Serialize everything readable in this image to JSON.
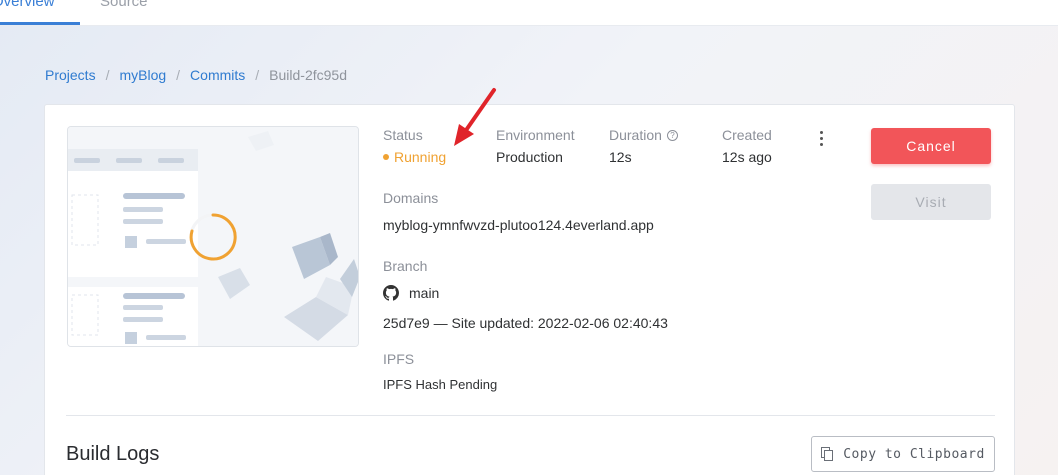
{
  "tabs": {
    "overview": "Overview",
    "source": "Source"
  },
  "breadcrumb": {
    "projects": "Projects",
    "project": "myBlog",
    "commits": "Commits",
    "current": "Build-2fc95d",
    "separator": "/"
  },
  "build": {
    "status_label": "Status",
    "status_value": "Running",
    "environment_label": "Environment",
    "environment_value": "Production",
    "duration_label": "Duration",
    "duration_value": "12s",
    "created_label": "Created",
    "created_value": "12s ago",
    "domains_label": "Domains",
    "domains_value": "myblog-ymnfwvzd-plutoo124.4everland.app",
    "branch_label": "Branch",
    "branch_value": "main",
    "commit_info": "25d7e9 — Site updated: 2022-02-06 02:40:43",
    "ipfs_label": "IPFS",
    "ipfs_value": "IPFS Hash Pending"
  },
  "actions": {
    "cancel_label": "Cancel",
    "visit_label": "Visit",
    "copy_label": "Copy to Clipboard"
  },
  "logs": {
    "title": "Build Logs"
  },
  "icons": {
    "help": "question-circle-icon",
    "more": "more-vertical-icon",
    "github": "github-icon",
    "copy": "copy-icon",
    "spinner": "loading-spinner-icon"
  },
  "colors": {
    "accent": "#3a7fd6",
    "running": "#f0a232",
    "danger": "#f25559",
    "annotation_arrow": "#e0242a"
  }
}
